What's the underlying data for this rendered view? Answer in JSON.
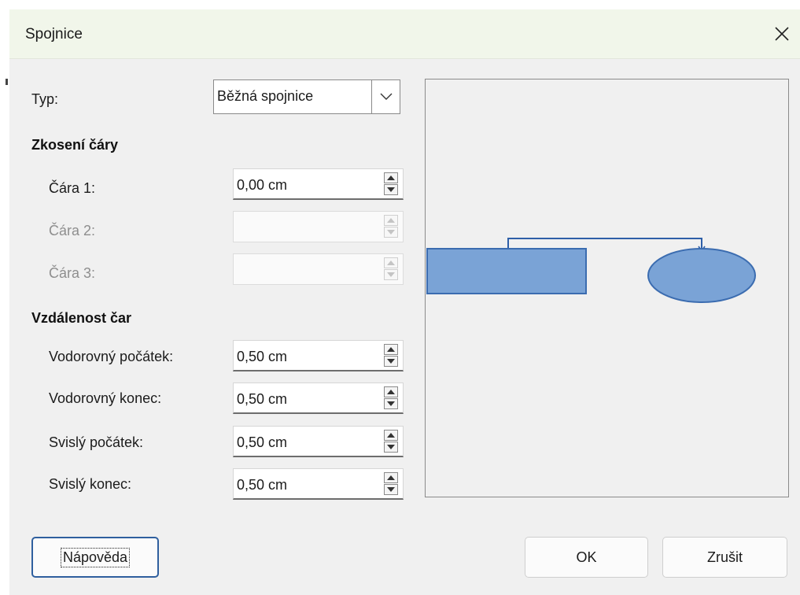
{
  "dialog": {
    "title": "Spojnice"
  },
  "type": {
    "label": "Typ:",
    "value": "Běžná spojnice"
  },
  "skew": {
    "heading": "Zkosení čáry",
    "line1": {
      "label": "Čára 1:",
      "value": "0,00 cm"
    },
    "line2": {
      "label": "Čára 2:",
      "value": ""
    },
    "line3": {
      "label": "Čára 3:",
      "value": ""
    }
  },
  "spacing": {
    "heading": "Vzdálenost čar",
    "h_start": {
      "label": "Vodorovný počátek:",
      "value": "0,50 cm"
    },
    "h_end": {
      "label": "Vodorovný konec:",
      "value": "0,50 cm"
    },
    "v_start": {
      "label": "Svislý počátek:",
      "value": "0,50 cm"
    },
    "v_end": {
      "label": "Svislý konec:",
      "value": "0,50 cm"
    }
  },
  "buttons": {
    "help": "Nápověda",
    "ok": "OK",
    "cancel": "Zrušit"
  },
  "preview": {
    "shape_fill": "#7aa3d6",
    "shape_stroke": "#3b6cb0",
    "connector_color": "#2e5fa8"
  }
}
